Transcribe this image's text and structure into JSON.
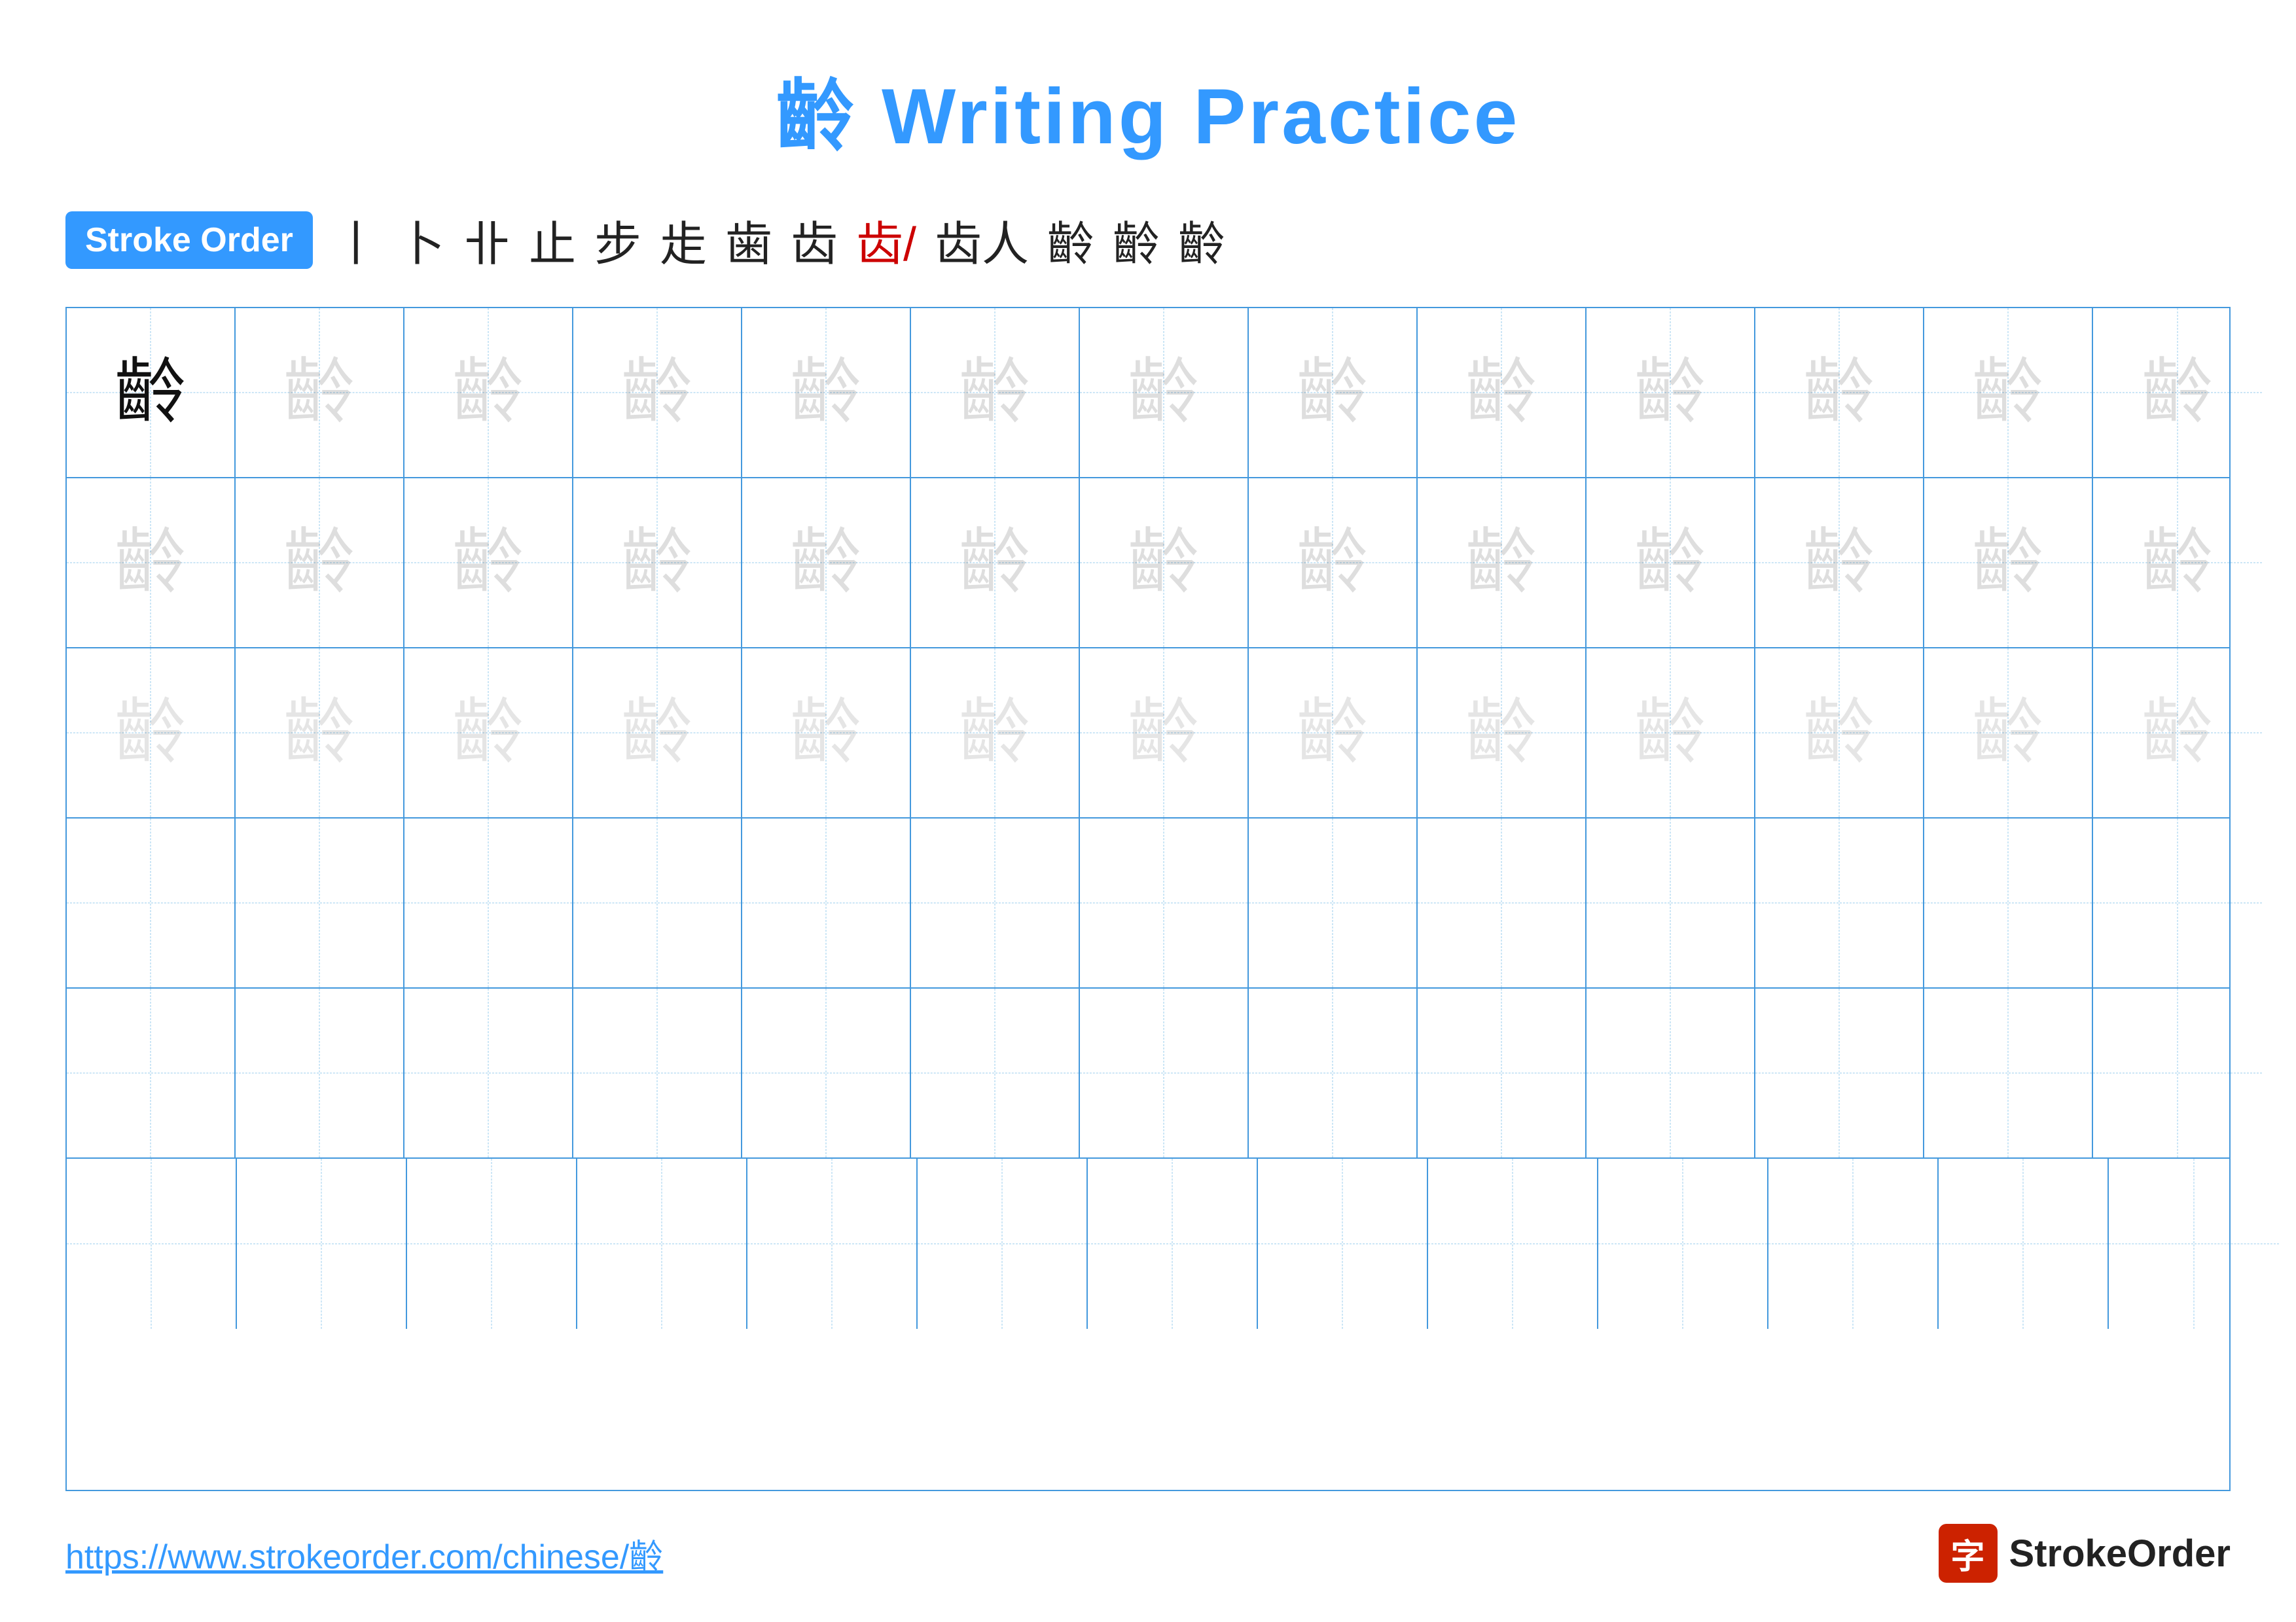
{
  "title": {
    "kanji": "齡",
    "text": "Writing Practice"
  },
  "stroke_order": {
    "badge_label": "Stroke Order",
    "strokes": [
      "丨",
      "卜",
      "卝",
      "止",
      "步",
      "步",
      "歯",
      "齿",
      "齿/",
      "齿人",
      "齡",
      "齡",
      "齡"
    ]
  },
  "grid": {
    "cols": 13,
    "rows": 6,
    "character": "齡"
  },
  "footer": {
    "url": "https://www.strokeorder.com/chinese/齡",
    "logo_icon": "字",
    "logo_text": "StrokeOrder"
  },
  "colors": {
    "blue": "#3399ff",
    "red": "#cc0000",
    "grid_border": "#4499dd",
    "grid_dashed": "#99ccee"
  }
}
